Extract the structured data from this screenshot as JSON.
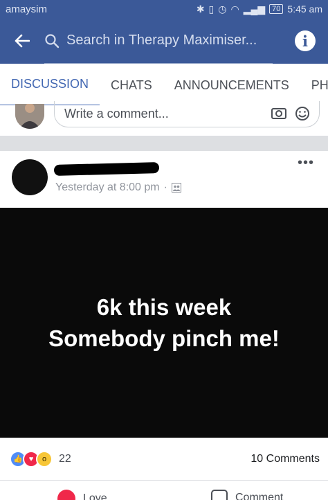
{
  "status_bar": {
    "carrier": "amaysim",
    "battery": "70",
    "time": "5:45 am"
  },
  "header": {
    "search_placeholder": "Search in Therapy Maximiser..."
  },
  "tabs": [
    {
      "label": "DISCUSSION",
      "active": true
    },
    {
      "label": "CHATS",
      "active": false
    },
    {
      "label": "ANNOUNCEMENTS",
      "active": false
    },
    {
      "label": "PHO",
      "active": false
    }
  ],
  "composer": {
    "placeholder": "Write a comment..."
  },
  "post": {
    "timestamp": "Yesterday at 8:00 pm",
    "separator": "·",
    "image_text": [
      "6k this week",
      "Somebody pinch me!"
    ],
    "reaction_count": "22",
    "comments_count": "10 Comments",
    "actions": [
      "Love",
      "Comment"
    ]
  },
  "colors": {
    "brand": "#3b5998",
    "tab_active": "#4267b2",
    "like": "#4f8cf7",
    "love": "#f0284a",
    "wow": "#f7c637"
  }
}
